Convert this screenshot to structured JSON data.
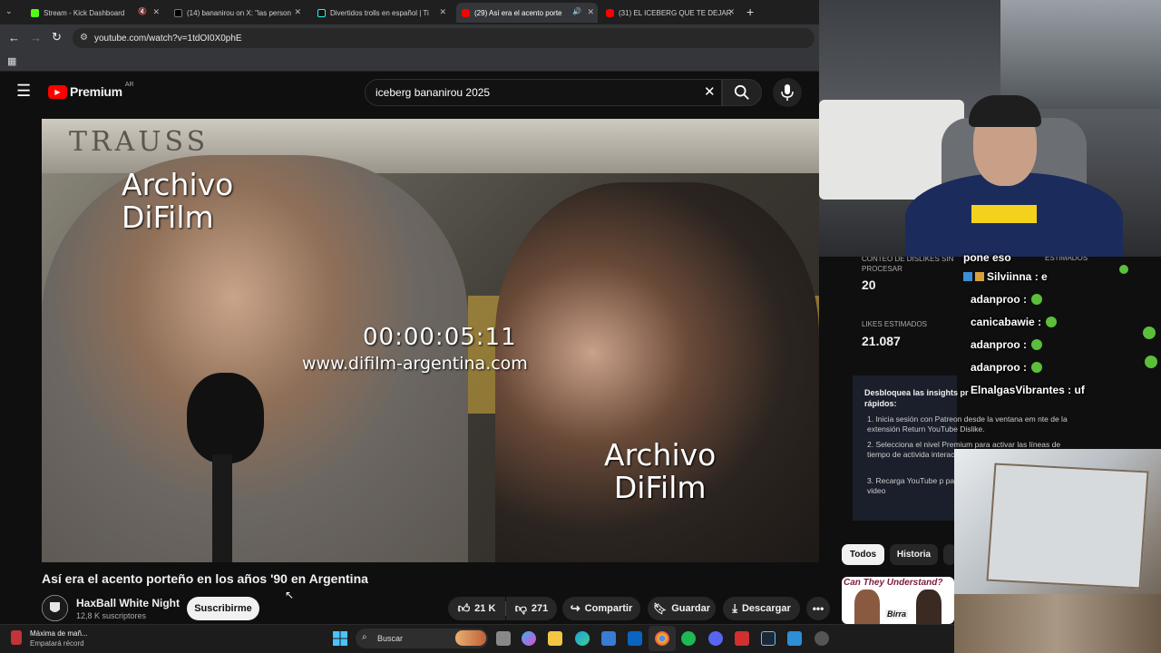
{
  "browser": {
    "tabs": [
      {
        "title": "Stream - Kick Dashboard",
        "active": false
      },
      {
        "title": "(14) bananirou on X: \"las person",
        "active": false
      },
      {
        "title": "Divertidos trolls en español | Ti",
        "active": false
      },
      {
        "title": "(29) Así era el acento porte",
        "active": true
      },
      {
        "title": "(31) EL ICEBERG QUE TE DEJAR",
        "active": false
      }
    ],
    "url": "youtube.com/watch?v=1tdOI0X0phE"
  },
  "youtube": {
    "logo_text": "Premium",
    "region": "AR",
    "search_value": "iceberg bananirou 2025",
    "video": {
      "overlay_top": "Archivo\nDiFilm",
      "timecode": "00:00:05:11",
      "site": "www.difilm-argentina.com",
      "overlay_bottom": "Archivo\nDiFilm",
      "sign": "TRAUSS"
    },
    "title": "Así era el acento porteño en los años '90 en Argentina",
    "channel": {
      "name": "HaxBall White Night",
      "subscribers": "12,8 K suscriptores",
      "subscribe_label": "Suscribirme"
    },
    "actions": {
      "likes": "21 K",
      "dislikes": "271",
      "share": "Compartir",
      "save": "Guardar",
      "download": "Descargar"
    },
    "rdpanel": {
      "unprocessed_label": "CONTEO DE DISLIKES SIN PROCESAR",
      "unprocessed_value": "20",
      "est_likes_label": "LIKES ESTIMADOS",
      "est_likes_value": "21.087",
      "est_col_label": "ESTIMADOS",
      "insight_title": "Desbloquea las insights pr",
      "insight_title2": "rápidos:",
      "steps": [
        "1.  Inicia sesión con Patreon desde la ventana em   nte de la extensión Return YouTube Dislike.",
        "2.  Selecciona el nivel Premium para activar las líneas de tiempo de activida   interactivo.",
        "3.  Recarga YouTube p   países principales y   UU. para cada video"
      ]
    },
    "chips": [
      "Todos",
      "Historia"
    ],
    "thumb_text": "Can They Understand?",
    "thumb_sub": "Birra"
  },
  "chat": [
    {
      "user": "pone eso",
      "msg": ""
    },
    {
      "user": "Silviinna",
      "msg": ": e"
    },
    {
      "user": "adanproo",
      "msg": ":"
    },
    {
      "user": "canicabawie",
      "msg": ":"
    },
    {
      "user": "adanproo",
      "msg": ":"
    },
    {
      "user": "adanproo",
      "msg": ":"
    },
    {
      "user": "ElnalgasVibrantes",
      "msg": ": uf"
    }
  ],
  "taskbar": {
    "weather_line1": "Máxima de mañ...",
    "weather_line2": "Empatará récord",
    "search_placeholder": "Buscar"
  },
  "colors": {
    "yt_red": "#ff0000",
    "bg": "#0f0f0f",
    "kick_green": "#53fc18",
    "chat_emote": "#5bbf3b"
  }
}
